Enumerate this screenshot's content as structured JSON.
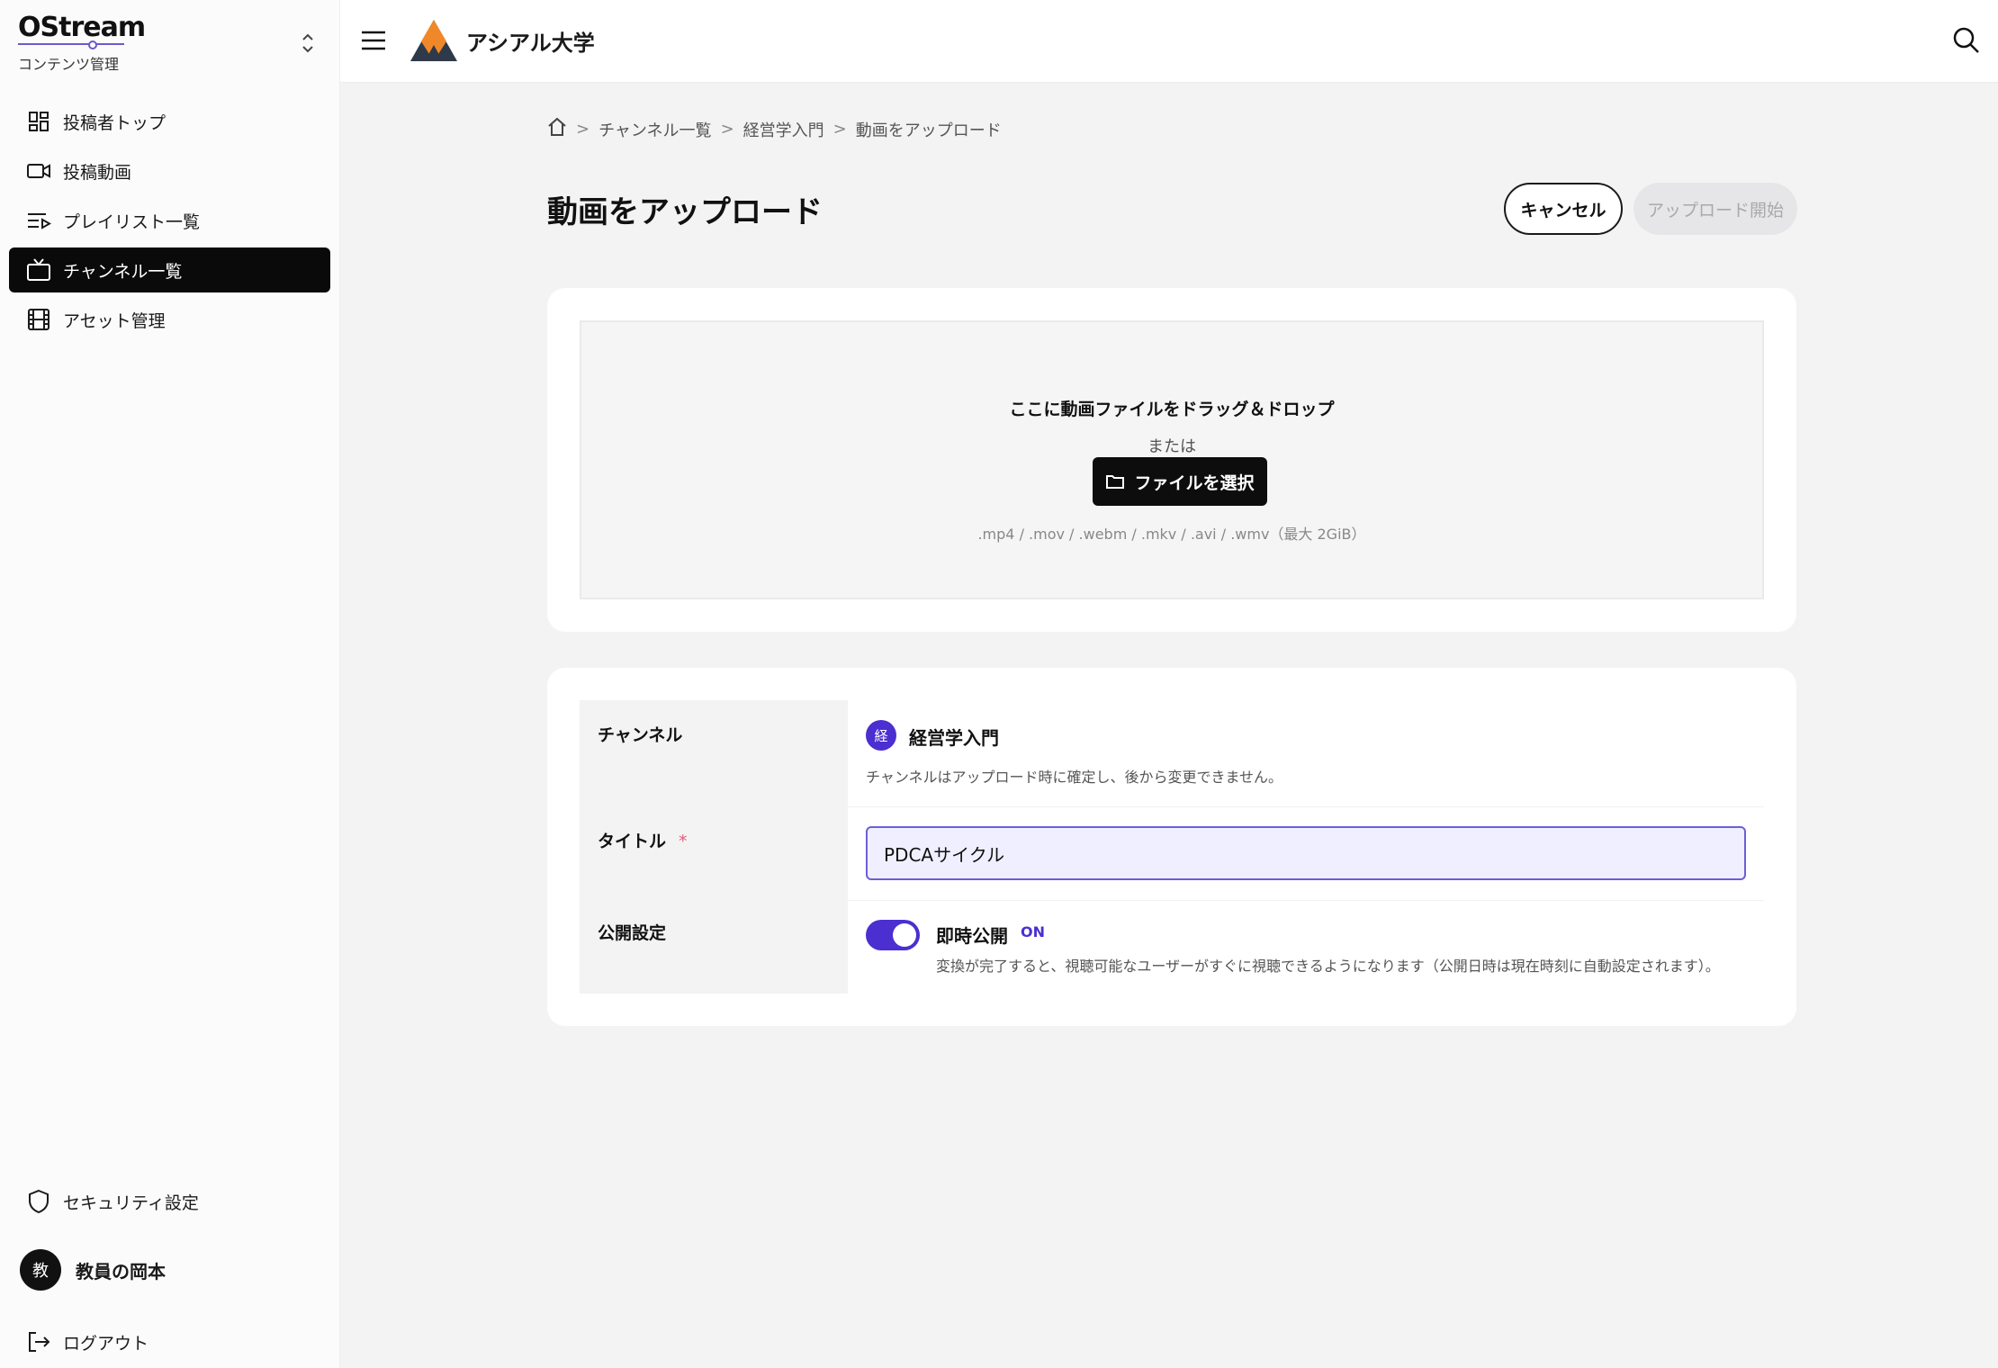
{
  "sidebar": {
    "brand": "OStream",
    "brand_sub": "コンテンツ管理",
    "items": [
      {
        "label": "投稿者トップ",
        "icon": "dashboard-icon"
      },
      {
        "label": "投稿動画",
        "icon": "video-camera-icon"
      },
      {
        "label": "プレイリスト一覧",
        "icon": "playlist-icon"
      },
      {
        "label": "チャンネル一覧",
        "icon": "tv-icon",
        "active": true
      },
      {
        "label": "アセット管理",
        "icon": "film-icon"
      }
    ],
    "security_label": "セキュリティ設定",
    "user_avatar": "教",
    "user_name": "教員の岡本",
    "logout_label": "ログアウト"
  },
  "header": {
    "org_name": "アシアル大学"
  },
  "breadcrumb": [
    "チャンネル一覧",
    "経営学入門",
    "動画をアップロード"
  ],
  "page": {
    "title": "動画をアップロード",
    "cancel_label": "キャンセル",
    "upload_label": "アップロード開始"
  },
  "dropzone": {
    "title": "ここに動画ファイルをドラッグ＆ドロップ",
    "or": "または",
    "button_label": "ファイルを選択",
    "formats": ".mp4 / .mov / .webm / .mkv / .avi / .wmv（最大 2GiB）"
  },
  "form": {
    "channel_label": "チャンネル",
    "channel_badge": "経",
    "channel_name": "経営学入門",
    "channel_note": "チャンネルはアップロード時に確定し、後から変更できません。",
    "title_label": "タイトル",
    "required_mark": "*",
    "title_value": "PDCAサイクル",
    "publish_label": "公開設定",
    "publish_toggle_label": "即時公開",
    "publish_state": "ON",
    "publish_note": "変換が完了すると、視聴可能なユーザーがすぐに視聴できるようになります（公開日時は現在時刻に自動設定されます）。"
  },
  "colors": {
    "accent": "#4b2fd0",
    "active_nav": "#0a0a0a"
  }
}
